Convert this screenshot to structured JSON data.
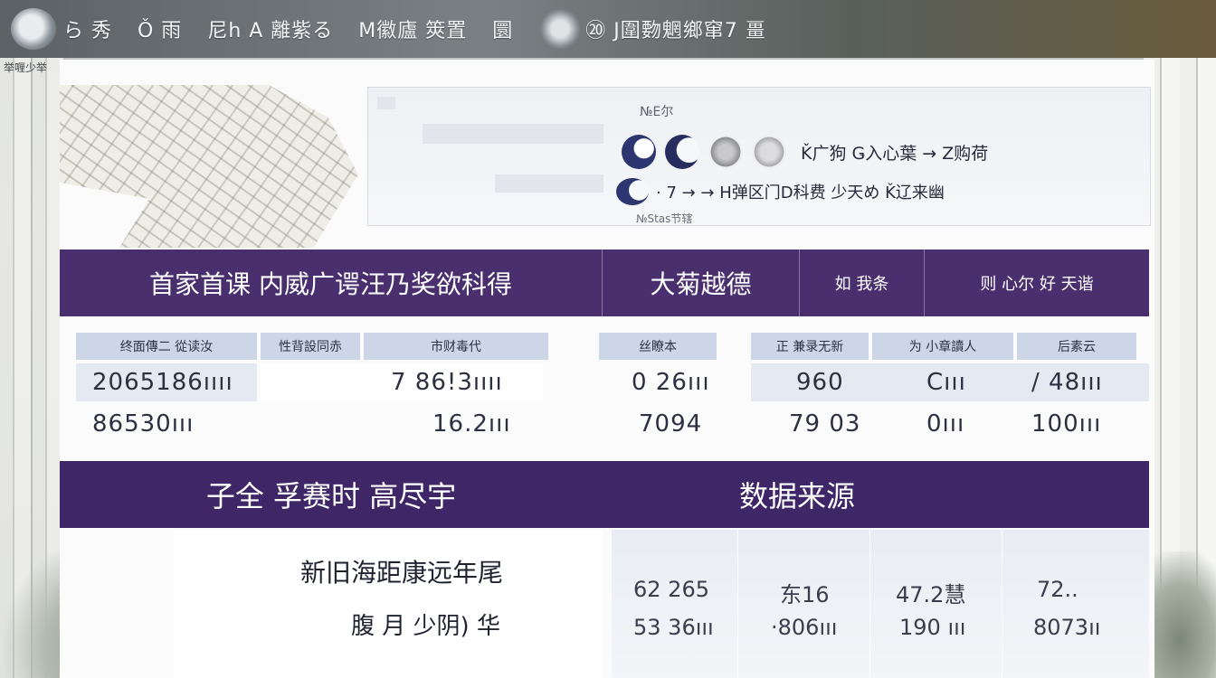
{
  "header": {
    "title_parts": [
      "ら 秀",
      "Ǒ 雨",
      "尼h A 離紫る",
      "M徽廬 筴置",
      "圜",
      "⑳ J圍覅魍鄉窜7 畺"
    ]
  },
  "sub_note": "举喱少举",
  "infocard": {
    "hint": "№E尔",
    "icon_row1_label": "Ǩ广狗 Ǥ入心葉 → Z购荷",
    "icon_row2_label": "· 7 → → H弹区门D科费 少天め Ǩ辽来幽",
    "foot": "№Stas节辖"
  },
  "band1": {
    "cells": [
      "首家首课  内威广谔汪乃奖欲科得",
      "大菊越德",
      "如 我条",
      "则 心尔  好 天谐"
    ]
  },
  "table": {
    "headers": [
      "终面傳二  從读汝",
      "性背設同赤",
      "市财毒代",
      "丝瞭本",
      "正 兼录无新",
      "为 小章讀人",
      "后素云"
    ],
    "row1": [
      "2065186ıııı",
      "7   86!3ıııı",
      "0 26ııı",
      "960",
      "Cııı",
      "∕ 48ııı"
    ],
    "row2": [
      "86530ııı",
      "16.2ııı",
      "7094",
      "79 03",
      "0ııı",
      "100ııı"
    ]
  },
  "band2": {
    "cells": [
      "子全  孚赛时  高尽宇",
      "数据来源"
    ]
  },
  "bottom": {
    "left_line1": "新旧海距康远年尾",
    "left_line2": "腹 月 少阴)  华",
    "values_row1": [
      "62 265",
      "东16",
      "47.2慧",
      "72.."
    ],
    "values_row2": [
      "53 36ııı",
      "·806ııı",
      "190 ııı",
      "8073ıı"
    ]
  },
  "colors": {
    "purple_band": "#4a2f6f",
    "purple_band_2": "#3f2767",
    "header_cell": "#cdd6e6"
  }
}
